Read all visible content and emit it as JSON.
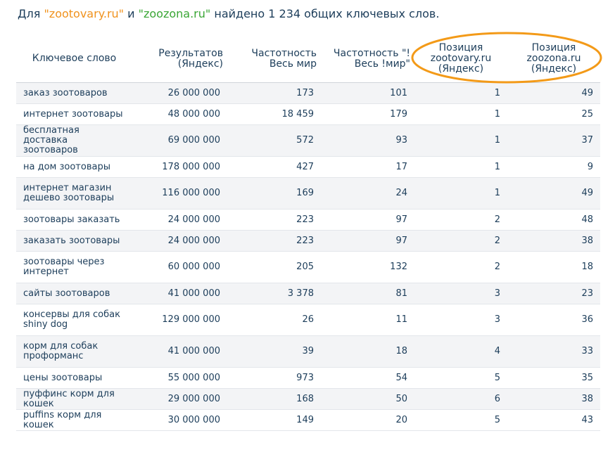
{
  "headline": {
    "prefix": "Для ",
    "site_a": "\"zootovary.ru\"",
    "middle": " и ",
    "site_b": "\"zoozona.ru\"",
    "suffix": " найдено 1 234 общих ключевых слов."
  },
  "colors": {
    "site_a": "#f0921d",
    "site_b": "#3aa635",
    "text": "#1c3d5a",
    "highlight_oval": "#f39a18"
  },
  "table": {
    "headers": {
      "keyword": "Ключевое слово",
      "results": "Результатов (Яндекс)",
      "freq_world": "Частотность Весь мир",
      "freq_exact": "Частотность \"!Весь !мир\"",
      "pos_a": "Позиция zootovary.ru (Яндекс)",
      "pos_b": "Позиция zoozona.ru (Яндекс)"
    },
    "rows": [
      {
        "keyword": "заказ зоотоваров",
        "results": "26 000 000",
        "freq_world": "173",
        "freq_exact": "101",
        "pos_a": "1",
        "pos_b": "49"
      },
      {
        "keyword": "интернет зоотовары",
        "results": "48 000 000",
        "freq_world": "18 459",
        "freq_exact": "179",
        "pos_a": "1",
        "pos_b": "25"
      },
      {
        "keyword": "бесплатная доставка зоотоваров",
        "results": "69 000 000",
        "freq_world": "572",
        "freq_exact": "93",
        "pos_a": "1",
        "pos_b": "37"
      },
      {
        "keyword": "на дом зоотовары",
        "results": "178 000 000",
        "freq_world": "427",
        "freq_exact": "17",
        "pos_a": "1",
        "pos_b": "9"
      },
      {
        "keyword": "интернет магазин дешево зоотовары",
        "results": "116 000 000",
        "freq_world": "169",
        "freq_exact": "24",
        "pos_a": "1",
        "pos_b": "49"
      },
      {
        "keyword": "зоотовары заказать",
        "results": "24 000 000",
        "freq_world": "223",
        "freq_exact": "97",
        "pos_a": "2",
        "pos_b": "48"
      },
      {
        "keyword": "заказать зоотовары",
        "results": "24 000 000",
        "freq_world": "223",
        "freq_exact": "97",
        "pos_a": "2",
        "pos_b": "38"
      },
      {
        "keyword": "зоотовары через интернет",
        "results": "60 000 000",
        "freq_world": "205",
        "freq_exact": "132",
        "pos_a": "2",
        "pos_b": "18"
      },
      {
        "keyword": "сайты зоотоваров",
        "results": "41 000 000",
        "freq_world": "3 378",
        "freq_exact": "81",
        "pos_a": "3",
        "pos_b": "23"
      },
      {
        "keyword": "консервы для собак shiny dog",
        "results": "129 000 000",
        "freq_world": "26",
        "freq_exact": "11",
        "pos_a": "3",
        "pos_b": "36"
      },
      {
        "keyword": "корм для собак проформанс",
        "results": "41 000 000",
        "freq_world": "39",
        "freq_exact": "18",
        "pos_a": "4",
        "pos_b": "33"
      },
      {
        "keyword": "цены зоотовары",
        "results": "55 000 000",
        "freq_world": "973",
        "freq_exact": "54",
        "pos_a": "5",
        "pos_b": "35"
      },
      {
        "keyword": "пуффинс корм для кошек",
        "results": "29 000 000",
        "freq_world": "168",
        "freq_exact": "50",
        "pos_a": "6",
        "pos_b": "38"
      },
      {
        "keyword": "puffins корм для кошек",
        "results": "30 000 000",
        "freq_world": "149",
        "freq_exact": "20",
        "pos_a": "5",
        "pos_b": "43"
      }
    ]
  }
}
